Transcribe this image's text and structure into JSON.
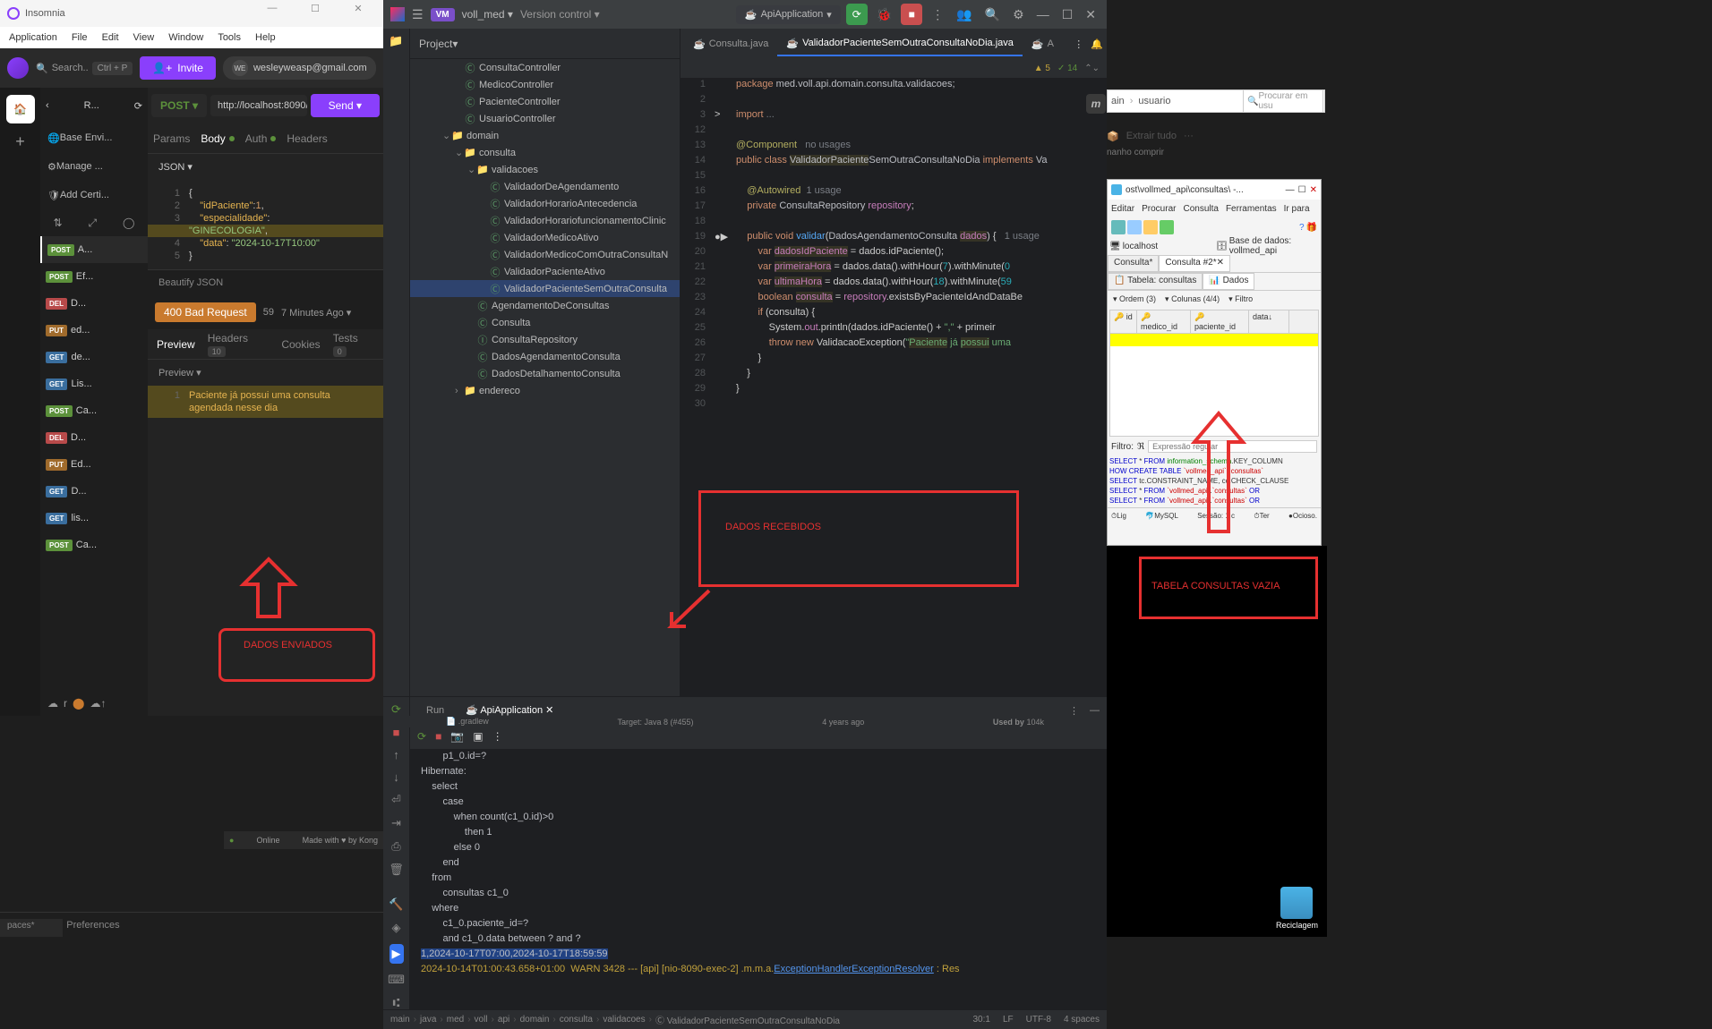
{
  "insomnia": {
    "title": "Insomnia",
    "menu": [
      "Application",
      "File",
      "Edit",
      "View",
      "Window",
      "Tools",
      "Help"
    ],
    "search_label": "Search..",
    "search_kbd": "Ctrl + P",
    "invite_label": "Invite",
    "user_email": "wesleyweasp@gmail.com",
    "user_initials": "WE",
    "nav_back": "‹",
    "nav_collection": "R...",
    "env_items": [
      "Base Envi...",
      "Manage ...",
      "Add Certi..."
    ],
    "requests": [
      {
        "method": "POST",
        "name": "A...",
        "active": true
      },
      {
        "method": "POST",
        "name": "Ef..."
      },
      {
        "method": "DEL",
        "name": "D..."
      },
      {
        "method": "PUT",
        "name": "ed..."
      },
      {
        "method": "GET",
        "name": "de..."
      },
      {
        "method": "GET",
        "name": "Lis..."
      },
      {
        "method": "POST",
        "name": "Ca..."
      },
      {
        "method": "DEL",
        "name": "D..."
      },
      {
        "method": "PUT",
        "name": "Ed..."
      },
      {
        "method": "GET",
        "name": "D..."
      },
      {
        "method": "GET",
        "name": "lis..."
      },
      {
        "method": "POST",
        "name": "Ca..."
      }
    ],
    "req_method": "POST",
    "req_url": "http://localhost:8090/",
    "send_label": "Send",
    "req_tabs": {
      "params": "Params",
      "body": "Body",
      "auth": "Auth",
      "headers": "Headers"
    },
    "json_dropdown": "JSON",
    "json_lines": [
      {
        "n": "1",
        "t": "{"
      },
      {
        "n": "2",
        "t": "    \"idPaciente\":1,"
      },
      {
        "n": "3",
        "t": "    \"especialidade\":"
      },
      {
        "n": "",
        "t": "\"GINECOLOGIA\","
      },
      {
        "n": "4",
        "t": "    \"data\": \"2024-10-17T10:00\""
      },
      {
        "n": "5",
        "t": "}"
      }
    ],
    "beautify": "Beautify JSON",
    "status_code": "400 Bad Request",
    "status_bytes": "59",
    "status_time": "7 Minutes Ago",
    "resp_tabs": {
      "preview": "Preview",
      "headers": "Headers",
      "headers_count": "10",
      "cookies": "Cookies",
      "tests": "Tests",
      "tests_count": "0"
    },
    "preview_label": "Preview",
    "resp_line1": "Paciente já possui uma consulta",
    "resp_line2": "agendada nesse dia",
    "preferences": "Preferences",
    "online": "Online",
    "made_with": "Made with ♥ by Kong",
    "paces": "paces*"
  },
  "intellij": {
    "project_name": "voll_med",
    "vm_label": "VM",
    "version_control": "Version control",
    "run_config": "ApiApplication",
    "project_label": "Project",
    "tree": [
      {
        "depth": 3,
        "type": "class",
        "name": "ConsultaController"
      },
      {
        "depth": 3,
        "type": "class",
        "name": "MedicoController"
      },
      {
        "depth": 3,
        "type": "class",
        "name": "PacienteController"
      },
      {
        "depth": 3,
        "type": "class",
        "name": "UsuarioController"
      },
      {
        "depth": 2,
        "type": "folder",
        "name": "domain",
        "arrow": "v"
      },
      {
        "depth": 3,
        "type": "folder",
        "name": "consulta",
        "arrow": "v"
      },
      {
        "depth": 4,
        "type": "folder",
        "name": "validacoes",
        "arrow": "v"
      },
      {
        "depth": 5,
        "type": "class",
        "name": "ValidadorDeAgendamento"
      },
      {
        "depth": 5,
        "type": "class",
        "name": "ValidadorHorarioAntecedencia"
      },
      {
        "depth": 5,
        "type": "class",
        "name": "ValidadorHorariofuncionamentoClinic"
      },
      {
        "depth": 5,
        "type": "class",
        "name": "ValidadorMedicoAtivo"
      },
      {
        "depth": 5,
        "type": "class",
        "name": "ValidadorMedicoComOutraConsultaN"
      },
      {
        "depth": 5,
        "type": "class",
        "name": "ValidadorPacienteAtivo"
      },
      {
        "depth": 5,
        "type": "class",
        "name": "ValidadorPacienteSemOutraConsulta",
        "selected": true
      },
      {
        "depth": 4,
        "type": "class",
        "name": "AgendamentoDeConsultas"
      },
      {
        "depth": 4,
        "type": "class",
        "name": "Consulta"
      },
      {
        "depth": 4,
        "type": "interface",
        "name": "ConsultaRepository"
      },
      {
        "depth": 4,
        "type": "class",
        "name": "DadosAgendamentoConsulta"
      },
      {
        "depth": 4,
        "type": "class",
        "name": "DadosDetalhamentoConsulta"
      },
      {
        "depth": 3,
        "type": "folder",
        "name": "endereco",
        "arrow": ">"
      }
    ],
    "tabs": [
      {
        "name": "Consulta.java",
        "active": false
      },
      {
        "name": "ValidadorPacienteSemOutraConsultaNoDia.java",
        "active": true
      },
      {
        "name": "A",
        "active": false
      }
    ],
    "editor_status": {
      "warnings": "5",
      "checks": "14"
    },
    "code": [
      {
        "n": "1",
        "html": "<span class='kw'>package</span> <span class='type'>med.voll.api.domain.consulta.validacoes;</span>"
      },
      {
        "n": "2",
        "html": ""
      },
      {
        "n": "3",
        "html": "<span class='kw'>import</span> <span class='comment'>...</span>",
        "fold": ">"
      },
      {
        "n": "12",
        "html": ""
      },
      {
        "n": "13",
        "html": "<span class='anno'>@Component</span>   <span class='comment'>no usages</span>"
      },
      {
        "n": "14",
        "html": "<span class='kw'>public class</span> <span class='type warn-bg'>ValidadorPaciente</span><span class='type'>SemOutraConsultaNoDia</span> <span class='kw'>implements</span> <span class='type'>Va</span>"
      },
      {
        "n": "15",
        "html": ""
      },
      {
        "n": "16",
        "html": "    <span class='anno'>@Autowired</span>  <span class='comment'>1 usage</span>"
      },
      {
        "n": "17",
        "html": "    <span class='kw'>private</span> <span class='type'>ConsultaRepository</span> <span class='field'>repository</span>;"
      },
      {
        "n": "18",
        "html": ""
      },
      {
        "n": "19",
        "html": "    <span class='kw'>public void</span> <span class='method'>validar</span>(<span class='type'>DadosAgendamentoConsulta</span> <span class='field warn-bg'>dados</span>) {   <span class='comment'>1 usage</span>",
        "gutter": "●▶"
      },
      {
        "n": "20",
        "html": "        <span class='kw'>var</span> <span class='field warn-bg'>dadosIdPaciente</span> = dados.idPaciente();"
      },
      {
        "n": "21",
        "html": "        <span class='kw'>var</span> <span class='field warn-bg'>primeiraHora</span> = dados.data().withHour(<span class='num'>7</span>).withMinute(<span class='num'>0</span>"
      },
      {
        "n": "22",
        "html": "        <span class='kw'>var</span> <span class='field warn-bg'>ultimaHora</span> = dados.data().withHour(<span class='num'>18</span>).withMinute(<span class='num'>59</span>"
      },
      {
        "n": "23",
        "html": "        <span class='kw'>boolean</span> <span class='field warn-bg'>consulta</span> = <span class='field'>repository</span>.existsByPacienteIdAndDataBe"
      },
      {
        "n": "24",
        "html": "        <span class='kw'>if</span> (consulta) {"
      },
      {
        "n": "25",
        "html": "            System.<span class='field'>out</span>.println(dados.idPaciente() + <span class='str'>\",\"</span> + primeir"
      },
      {
        "n": "26",
        "html": "            <span class='kw'>throw new</span> ValidacaoException(<span class='str'>\"</span><span class='str warn-bg'>Paciente</span> <span class='str'>já</span> <span class='str warn-bg'>possui</span> <span class='str'>uma </span>"
      },
      {
        "n": "27",
        "html": "        }"
      },
      {
        "n": "28",
        "html": "    }"
      },
      {
        "n": "29",
        "html": "}"
      },
      {
        "n": "30",
        "html": ""
      }
    ],
    "bottom_tabs": {
      "run": "Run",
      "api": "ApiApplication"
    },
    "console": [
      "        p1_0.id=?",
      "Hibernate:",
      "    select",
      "        case",
      "            when count(c1_0.id)>0",
      "                then 1",
      "            else 0",
      "        end",
      "    from",
      "        consultas c1_0",
      "    where",
      "        c1_0.paciente_id=?",
      "        and c1_0.data between ? and ?"
    ],
    "console_sel": "1,2024-10-17T07:00,2024-10-17T18:59:59",
    "console_warn": "2024-10-14T01:00:43.658+01:00  WARN 3428 --- [api] [nio-8090-exec-2] .m.m.a.ExceptionHandlerExceptionResolver : Res",
    "breadcrumb": [
      "main",
      "java",
      "med",
      "voll",
      "api",
      "domain",
      "consulta",
      "validacoes",
      "ValidadorPacienteSemOutraConsultaNoDia"
    ],
    "status_right": {
      "pos": "30:1",
      "le": "LF",
      "enc": "UTF-8",
      "indent": "4 spaces"
    },
    "gradlew": ".gradlew",
    "target": "Target: Java 8 (#455)",
    "years_ago": "4 years ago",
    "used_by": "Used by",
    "used_by_count": "104k"
  },
  "heidi": {
    "title": "ost\\vollmed_api\\consultas\\ -...",
    "menu": [
      "Editar",
      "Procurar",
      "Consulta",
      "Ferramentas",
      "Ir para"
    ],
    "tree": {
      "root": "localhost",
      "db": "Base de dados: vollmed_api"
    },
    "tabs": [
      "Consulta*",
      "Consulta #2*✕"
    ],
    "table_tab": "Tabela: consultas",
    "dados_tab": "Dados",
    "ordem": "Ordem (3)",
    "colunas": "Colunas (4/4)",
    "filtro": "Filtro",
    "cols": [
      "id",
      "medico_id",
      "paciente_id",
      "data"
    ],
    "filter_label": "Filtro:",
    "filter_placeholder": "Expressão regular",
    "sql": [
      "SELECT * FROM information_schema.KEY_COLUMN",
      "HOW CREATE TABLE `vollmed_api`.`consultas`",
      "SELECT tc.CONSTRAINT_NAME, cc.CHECK_CLAUSE",
      "SELECT * FROM `vollmed_api`.`consultas` OR",
      "SELECT * FROM `vollmed_api`.`consultas` OR"
    ],
    "status": {
      "lig": "Lig",
      "mysql": "MySQL",
      "sessao": "Sessão: 1 c",
      "ter": "Ter",
      "ocioso": "Ocioso."
    }
  },
  "explorer": {
    "crumb1": "ain",
    "crumb2": "usuario",
    "search": "Procurar em usu",
    "extrair": "Extrair tudo",
    "dots": "···",
    "tamanho": "nanho comprir"
  },
  "annotations": {
    "dados_enviados": "DADOS ENVIADOS",
    "dados_recebidos": "DADOS RECEBIDOS",
    "tabela_vazia": "TABELA CONSULTAS VAZIA"
  },
  "recycle": "Reciclagem"
}
